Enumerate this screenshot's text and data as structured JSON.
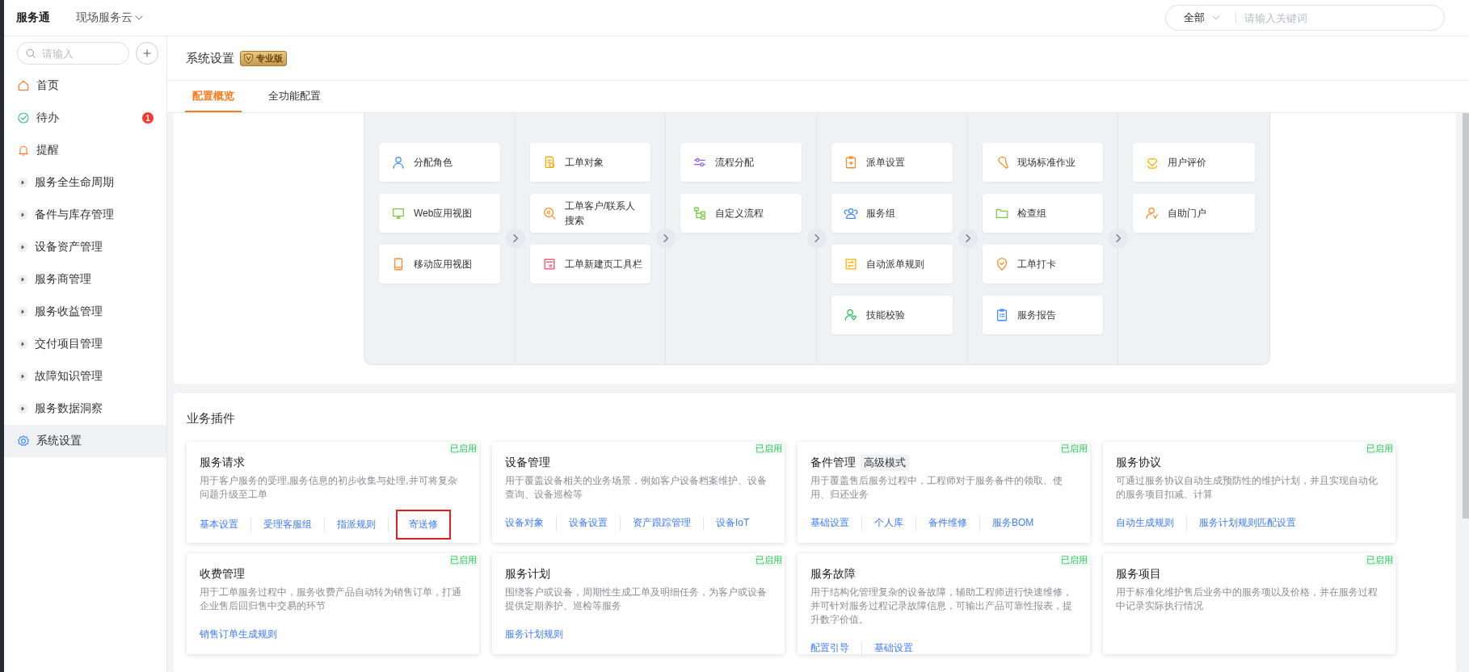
{
  "topbar": {
    "app_name": "服务通",
    "workspace": "现场服务云",
    "search": {
      "scope": "全部",
      "placeholder": "请输入关键词"
    }
  },
  "sidebar": {
    "search_placeholder": "请输入",
    "items": [
      {
        "label": "首页",
        "kind": "page",
        "selected": false
      },
      {
        "label": "待办",
        "kind": "page",
        "selected": false,
        "badge": "1"
      },
      {
        "label": "提醒",
        "kind": "page",
        "selected": false
      },
      {
        "label": "服务全生命周期",
        "kind": "group",
        "selected": false
      },
      {
        "label": "备件与库存管理",
        "kind": "group",
        "selected": false
      },
      {
        "label": "设备资产管理",
        "kind": "group",
        "selected": false
      },
      {
        "label": "服务商管理",
        "kind": "group",
        "selected": false
      },
      {
        "label": "服务收益管理",
        "kind": "group",
        "selected": false
      },
      {
        "label": "交付项目管理",
        "kind": "group",
        "selected": false
      },
      {
        "label": "故障知识管理",
        "kind": "group",
        "selected": false
      },
      {
        "label": "服务数据洞察",
        "kind": "group",
        "selected": false
      },
      {
        "label": "系统设置",
        "kind": "page",
        "selected": true
      }
    ]
  },
  "header": {
    "title": "系统设置",
    "edition_badge": "专业版"
  },
  "tabs": [
    {
      "label": "配置概览",
      "selected": true
    },
    {
      "label": "全功能配置",
      "selected": false
    }
  ],
  "flow": {
    "columns": [
      [
        {
          "label": "分配角色"
        },
        {
          "label": "Web应用视图"
        },
        {
          "label": "移动应用视图"
        }
      ],
      [
        {
          "label": "工单对象"
        },
        {
          "label": "工单客户/联系人搜索"
        },
        {
          "label": "工单新建页工具栏"
        }
      ],
      [
        {
          "label": "流程分配"
        },
        {
          "label": "自定义流程"
        }
      ],
      [
        {
          "label": "派单设置"
        },
        {
          "label": "服务组"
        },
        {
          "label": "自动派单规则"
        },
        {
          "label": "技能校验"
        }
      ],
      [
        {
          "label": "现场标准作业"
        },
        {
          "label": "检查组"
        },
        {
          "label": "工单打卡"
        },
        {
          "label": "服务报告"
        }
      ],
      [
        {
          "label": "用户评价"
        },
        {
          "label": "自助门户"
        }
      ]
    ]
  },
  "plugins": {
    "title": "业务插件",
    "cards": [
      {
        "title": "服务请求",
        "status": "已启用",
        "description": "用于客户服务的受理,服务信息的初步收集与处理,并可将复杂问题升级至工单",
        "links": [
          {
            "label": "基本设置",
            "highlighted": false
          },
          {
            "label": "受理客服组",
            "highlighted": false
          },
          {
            "label": "指派规则",
            "highlighted": false
          },
          {
            "label": "寄送修",
            "highlighted": true
          }
        ]
      },
      {
        "title": "设备管理",
        "status": "已启用",
        "description": "用于覆盖设备相关的业务场景，例如客户设备档案维护、设备查询、设备巡检等",
        "links": [
          {
            "label": "设备对象",
            "highlighted": false
          },
          {
            "label": "设备设置",
            "highlighted": false
          },
          {
            "label": "资产跟踪管理",
            "highlighted": false
          },
          {
            "label": "设备IoT",
            "highlighted": false
          }
        ]
      },
      {
        "title": "备件管理",
        "mode_tag": "高级模式",
        "status": "已启用",
        "description": "用于覆盖售后服务过程中，工程师对于服务备件的领取、使用、归还业务",
        "links": [
          {
            "label": "基础设置",
            "highlighted": false
          },
          {
            "label": "个人库",
            "highlighted": false
          },
          {
            "label": "备件维修",
            "highlighted": false
          },
          {
            "label": "服务BOM",
            "highlighted": false
          }
        ]
      },
      {
        "title": "服务协议",
        "status": "已启用",
        "description": "可通过服务协议自动生成预防性的维护计划，并且实现自动化的服务项目扣减、计算",
        "links": [
          {
            "label": "自动生成规则",
            "highlighted": false
          },
          {
            "label": "服务计划规则匹配设置",
            "highlighted": false
          }
        ]
      },
      {
        "title": "收费管理",
        "status": "已启用",
        "description": "用于工单服务过程中，服务收费产品自动转为销售订单，打通企业售后回归售中交易的环节",
        "links": [
          {
            "label": "销售订单生成规则",
            "highlighted": false
          }
        ]
      },
      {
        "title": "服务计划",
        "status": "已启用",
        "description": "围绕客户或设备，周期性生成工单及明细任务，为客户或设备提供定期养护、巡检等服务",
        "links": [
          {
            "label": "服务计划规则",
            "highlighted": false
          }
        ]
      },
      {
        "title": "服务故障",
        "status": "已启用",
        "description": "用于结构化管理复杂的设备故障，辅助工程师进行快速维修，并可针对服务过程记录故障信息，可输出产品可靠性报表，提升数字价值。",
        "links": [
          {
            "label": "配置引导",
            "highlighted": false
          },
          {
            "label": "基础设置",
            "highlighted": false
          }
        ]
      },
      {
        "title": "服务项目",
        "status": "已启用",
        "description": "用于标准化维护售后业务中的服务项以及价格，并在服务过程中记录实际执行情况"
      }
    ]
  }
}
